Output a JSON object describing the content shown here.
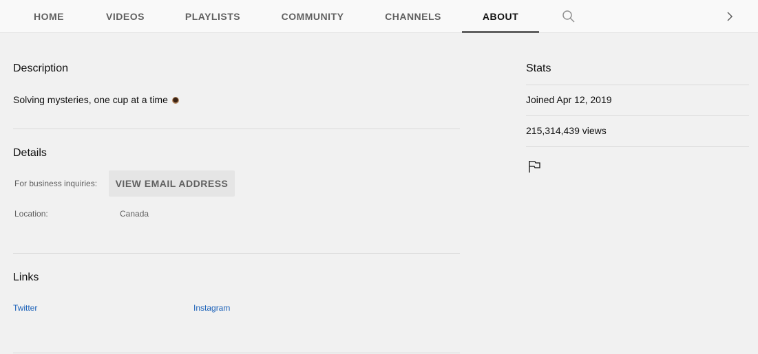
{
  "tabs": [
    {
      "label": "HOME"
    },
    {
      "label": "VIDEOS"
    },
    {
      "label": "PLAYLISTS"
    },
    {
      "label": "COMMUNITY"
    },
    {
      "label": "CHANNELS"
    },
    {
      "label": "ABOUT",
      "active": true
    }
  ],
  "icons": {
    "search": "search-icon",
    "next": "chevron-right-icon",
    "flag": "flag-icon",
    "emoji": "coffee-cup-icon"
  },
  "description": {
    "title": "Description",
    "text": "Solving mysteries, one cup at a time"
  },
  "details": {
    "title": "Details",
    "business_label": "For business inquiries:",
    "email_button": "VIEW EMAIL ADDRESS",
    "location_label": "Location:",
    "location_value": "Canada"
  },
  "links": {
    "title": "Links",
    "items": [
      {
        "label": "Twitter"
      },
      {
        "label": "Instagram"
      }
    ]
  },
  "stats": {
    "title": "Stats",
    "joined": "Joined Apr 12, 2019",
    "views": "215,314,439 views"
  },
  "colors": {
    "background": "#f1f1f1",
    "tabbar": "#f9f9f9",
    "link": "#1c62b9",
    "button": "#e5e5e5"
  }
}
